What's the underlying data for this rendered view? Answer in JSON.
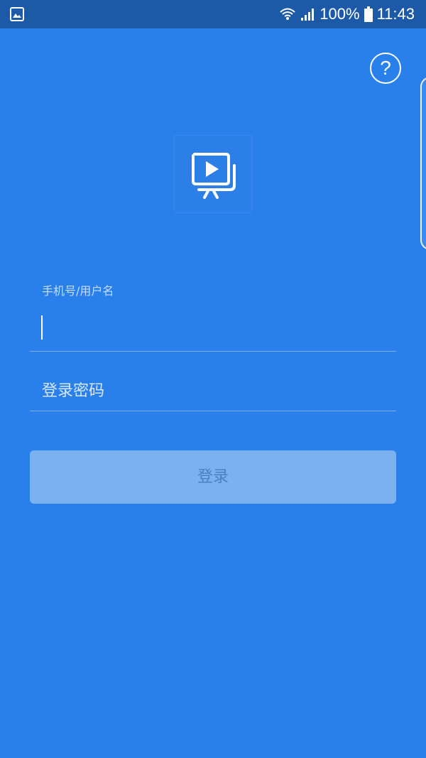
{
  "status_bar": {
    "battery": "100%",
    "time": "11:43",
    "left_icon": "gallery-image-icon",
    "wifi_icon": "wifi-icon",
    "signal_icon": "signal-icon",
    "battery_icon": "battery-icon"
  },
  "header": {
    "help_symbol": "?",
    "help_icon": "help-circle-icon"
  },
  "logo": {
    "icon": "video-presentation-icon"
  },
  "form": {
    "username_label": "手机号/用户名",
    "username_value": "",
    "password_placeholder": "登录密码",
    "login_button": "登录"
  },
  "colors": {
    "background": "#2a80ea",
    "status_bar": "#1c5aa8",
    "button_bg": "#7bb0f1",
    "button_text": "#4a7fc4"
  }
}
